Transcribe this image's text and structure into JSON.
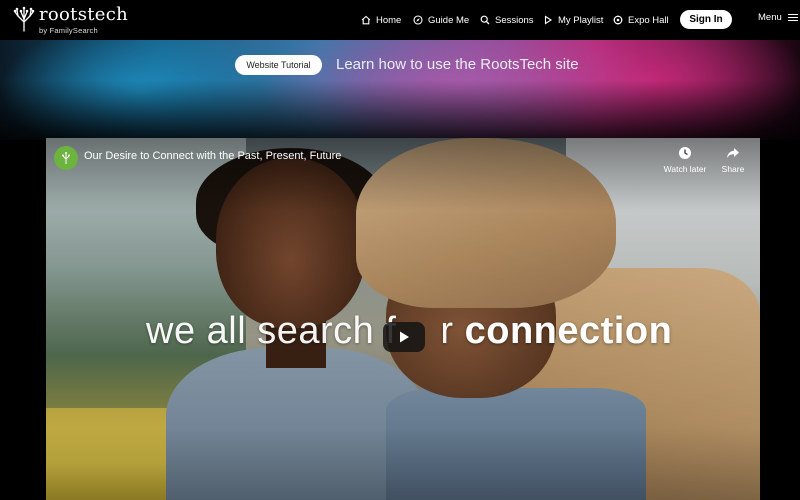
{
  "header": {
    "logo": {
      "wordmark": "rootstech",
      "sub": "by FamilySearch"
    },
    "nav": [
      {
        "label": "Home",
        "icon": "home-icon"
      },
      {
        "label": "Guide Me",
        "icon": "compass-icon"
      },
      {
        "label": "Sessions",
        "icon": "search-icon"
      },
      {
        "label": "My Playlist",
        "icon": "play-icon"
      },
      {
        "label": "Expo Hall",
        "icon": "expo-icon"
      }
    ],
    "sign_in": "Sign In",
    "menu": "Menu"
  },
  "banner": {
    "button": "Website Tutorial",
    "text": "Learn how to use the RootsTech site"
  },
  "video": {
    "title": "Our Desire to Connect with the Past, Present, Future",
    "watch_later": "Watch later",
    "share": "Share",
    "caption_part1": "we all search f",
    "caption_part2": "r ",
    "caption_part3": "connection"
  },
  "colors": {
    "accent_green": "#6db33f",
    "banner_blue": "#1e8cbe",
    "banner_magenta": "#b02e7e"
  }
}
